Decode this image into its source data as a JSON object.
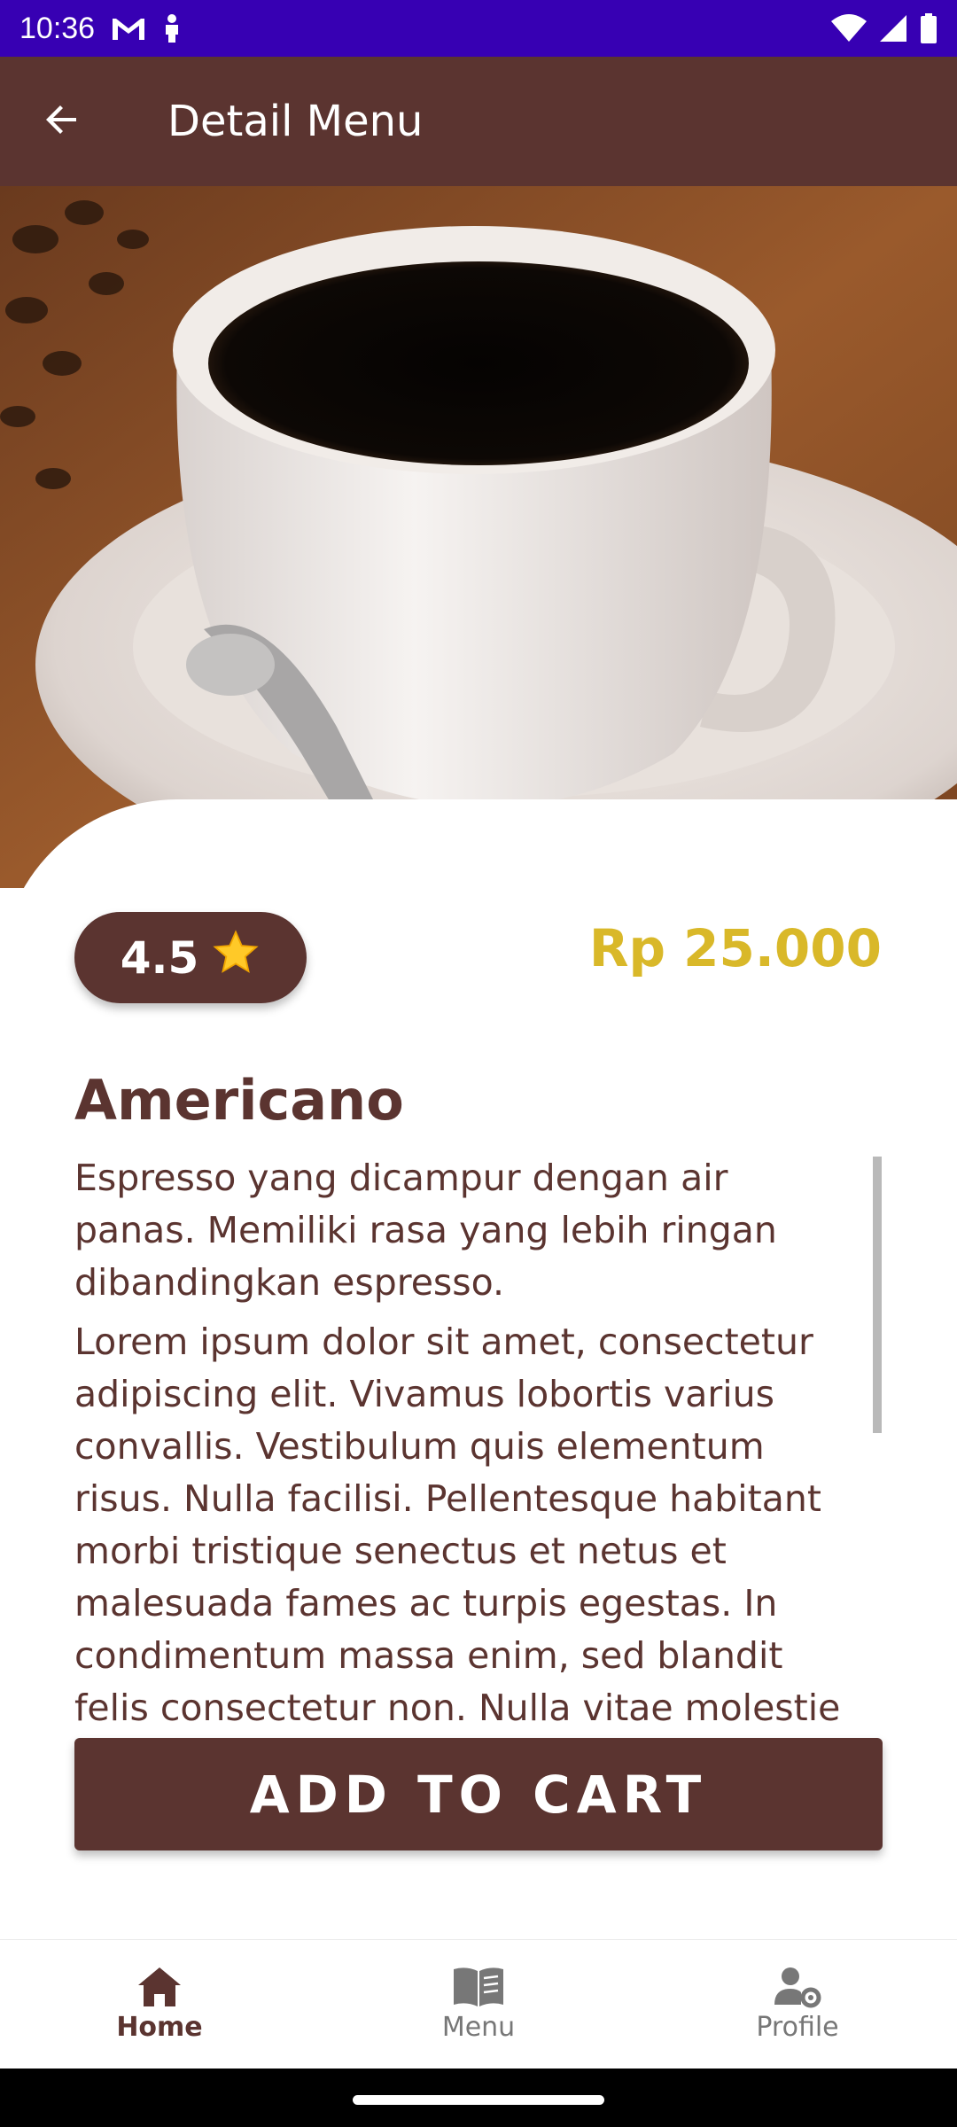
{
  "status_bar": {
    "time": "10:36",
    "background": "#3700b3",
    "icons": [
      "gmail-icon",
      "notification-person-icon",
      "wifi-icon",
      "signal-icon",
      "battery-icon"
    ]
  },
  "app_bar": {
    "title": "Detail Menu",
    "background": "#5b3430",
    "back_icon": "arrow-back-icon"
  },
  "product": {
    "image": "coffee-cup-photo",
    "rating": "4.5",
    "rating_icon": "star-icon",
    "price": "Rp 25.000",
    "name": "Americano",
    "description_short": "Espresso yang dicampur dengan air panas. Memiliki rasa yang lebih ringan dibandingkan espresso.",
    "description_long": "Lorem ipsum dolor sit amet, consectetur adipiscing elit. Vivamus lobortis varius convallis. Vestibulum quis elementum risus. Nulla facilisi. Pellentesque habitant morbi tristique senectus et netus et malesuada fames ac turpis egestas. In condimentum massa enim, sed blandit felis consectetur non. Nulla vitae molestie"
  },
  "actions": {
    "add_to_cart": "ADD TO CART"
  },
  "bottom_nav": {
    "items": [
      {
        "label": "Home",
        "icon": "home-icon",
        "active": true
      },
      {
        "label": "Menu",
        "icon": "book-icon",
        "active": false
      },
      {
        "label": "Profile",
        "icon": "user-settings-icon",
        "active": false
      }
    ]
  },
  "colors": {
    "primary": "#5b3430",
    "price": "#d9b829",
    "inactive_nav": "#777777"
  }
}
